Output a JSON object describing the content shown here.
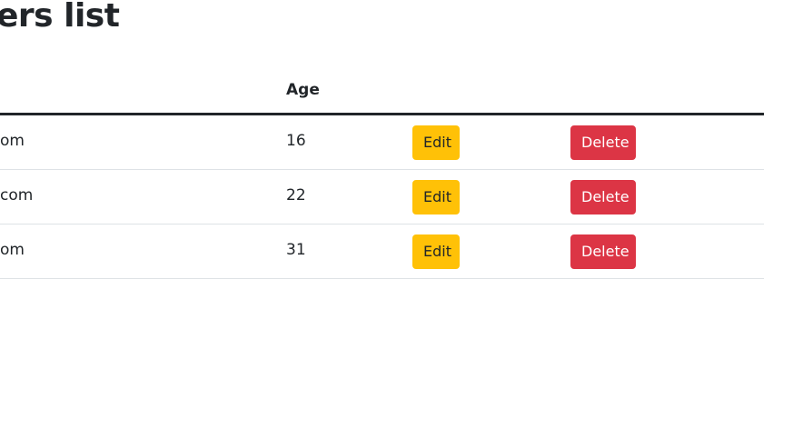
{
  "page": {
    "title": "ers list"
  },
  "table": {
    "headers": {
      "age": "Age"
    },
    "rows": [
      {
        "email": "om",
        "age": "16",
        "edit_label": "Edit",
        "delete_label": "Delete"
      },
      {
        "email": "com",
        "age": "22",
        "edit_label": "Edit",
        "delete_label": "Delete"
      },
      {
        "email": "om",
        "age": "31",
        "edit_label": "Edit",
        "delete_label": "Delete"
      }
    ]
  },
  "colors": {
    "edit_button": "#ffc107",
    "delete_button": "#dc3545",
    "header_border": "#212529",
    "row_border": "#dee2e6"
  }
}
